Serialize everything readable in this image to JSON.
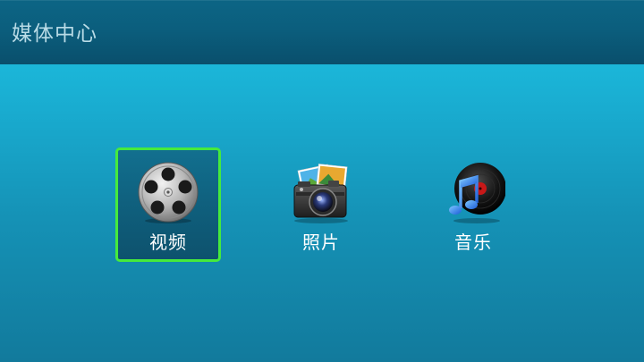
{
  "header": {
    "title": "媒体中心"
  },
  "menu": {
    "items": [
      {
        "label": "视频",
        "icon": "film-reel-icon",
        "selected": true
      },
      {
        "label": "照片",
        "icon": "camera-photos-icon",
        "selected": false
      },
      {
        "label": "音乐",
        "icon": "music-record-icon",
        "selected": false
      }
    ]
  },
  "colors": {
    "selection_border": "#46ea3c",
    "header_bg": "#0b5e7d",
    "content_bg": "#1aaed2"
  }
}
